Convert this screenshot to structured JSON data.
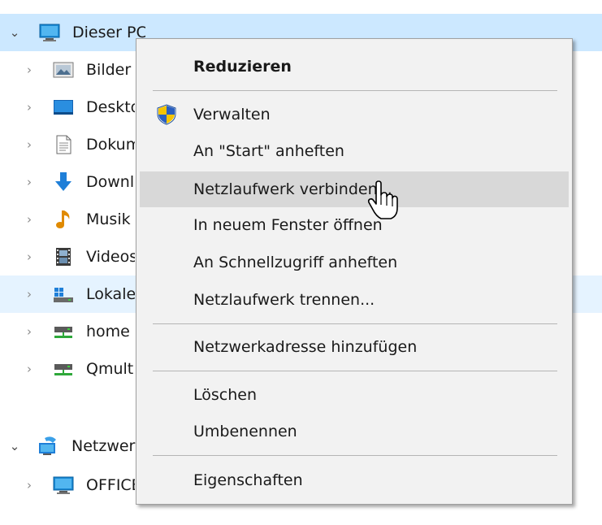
{
  "tree": {
    "items": [
      {
        "label": "Dieser PC",
        "icon": "pc-icon",
        "expanded": true
      },
      {
        "label": "Bilder",
        "icon": "pictures-folder-icon"
      },
      {
        "label": "Desktop",
        "icon": "desktop-folder-icon"
      },
      {
        "label": "Dokumente",
        "icon": "documents-folder-icon"
      },
      {
        "label": "Downloads",
        "icon": "downloads-folder-icon"
      },
      {
        "label": "Musik",
        "icon": "music-folder-icon"
      },
      {
        "label": "Videos",
        "icon": "videos-folder-icon"
      },
      {
        "label": "Lokaler Datenträger",
        "icon": "local-drive-icon"
      },
      {
        "label": "home",
        "icon": "network-drive-icon"
      },
      {
        "label": "Qmultimedia",
        "icon": "network-drive-icon"
      },
      {
        "label": "Netzwerk",
        "icon": "network-icon",
        "expanded": true
      },
      {
        "label": "OFFICE",
        "icon": "computer-icon"
      }
    ]
  },
  "context_menu": {
    "items": {
      "reduzieren": "Reduzieren",
      "verwalten": "Verwalten",
      "an_start_anheften": "An \"Start\" anheften",
      "netzlaufwerk_verbinden": "Netzlaufwerk verbinden...",
      "in_neuem_fenster": "In neuem Fenster öffnen",
      "an_schnellzugriff": "An Schnellzugriff anheften",
      "netzlaufwerk_trennen": "Netzlaufwerk trennen...",
      "netzwerkadresse": "Netzwerkadresse hinzufügen",
      "loeschen": "Löschen",
      "umbenennen": "Umbenennen",
      "eigenschaften": "Eigenschaften"
    },
    "hovered_item": "netzlaufwerk_verbinden"
  },
  "colors": {
    "selected_row": "#cce8ff",
    "hover_row": "#e5f3ff",
    "menu_bg": "#f2f2f2",
    "menu_highlight": "#d8d8d8"
  }
}
